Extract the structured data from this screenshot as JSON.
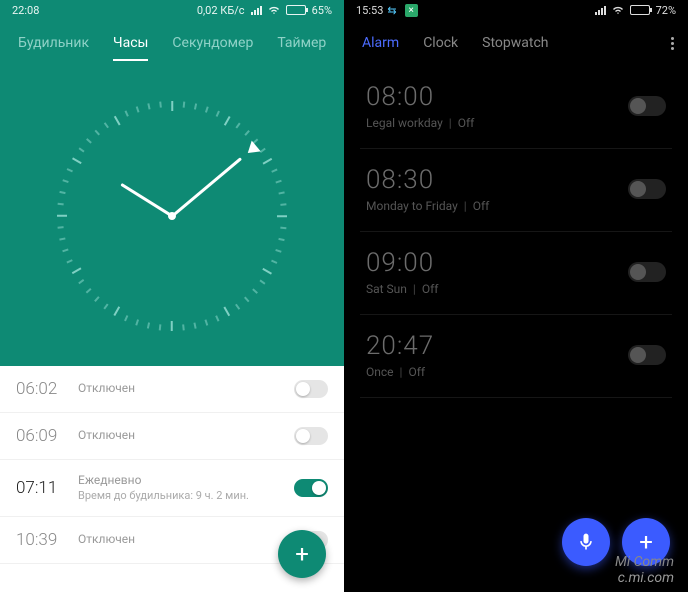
{
  "left": {
    "status": {
      "time": "22:08",
      "net": "0,02 КБ/с",
      "battery": "65%",
      "battery_fill": 65
    },
    "tabs": {
      "items": [
        "Будильник",
        "Часы",
        "Секундомер",
        "Таймер"
      ],
      "active": 1
    },
    "clock": {
      "hour_angle": 302,
      "minute_angle": 50,
      "marker_angle": 50
    },
    "alarms": [
      {
        "time": "06:02",
        "label": "Отключен",
        "sub": "",
        "on": false
      },
      {
        "time": "06:09",
        "label": "Отключен",
        "sub": "",
        "on": false
      },
      {
        "time": "07:11",
        "label": "Ежедневно",
        "sub": "Время до будильника: 9 ч. 2 мин.",
        "on": true
      },
      {
        "time": "10:39",
        "label": "Отключен",
        "sub": "",
        "on": false
      }
    ]
  },
  "right": {
    "status": {
      "time": "15:53",
      "battery": "72%",
      "battery_fill": 72
    },
    "tabs": {
      "items": [
        "Alarm",
        "Clock",
        "Stopwatch"
      ],
      "active": 0
    },
    "alarms": [
      {
        "time": "08:00",
        "label": "Legal workday",
        "state": "Off",
        "on": false
      },
      {
        "time": "08:30",
        "label": "Monday to Friday",
        "state": "Off",
        "on": false
      },
      {
        "time": "09:00",
        "label": "Sat Sun",
        "state": "Off",
        "on": false
      },
      {
        "time": "20:47",
        "label": "Once",
        "state": "Off",
        "on": false
      }
    ],
    "watermark": {
      "l1": "Mi Comm",
      "l2": "c.mi.com"
    }
  },
  "glyphs": {
    "plus": "+",
    "x": "×"
  }
}
